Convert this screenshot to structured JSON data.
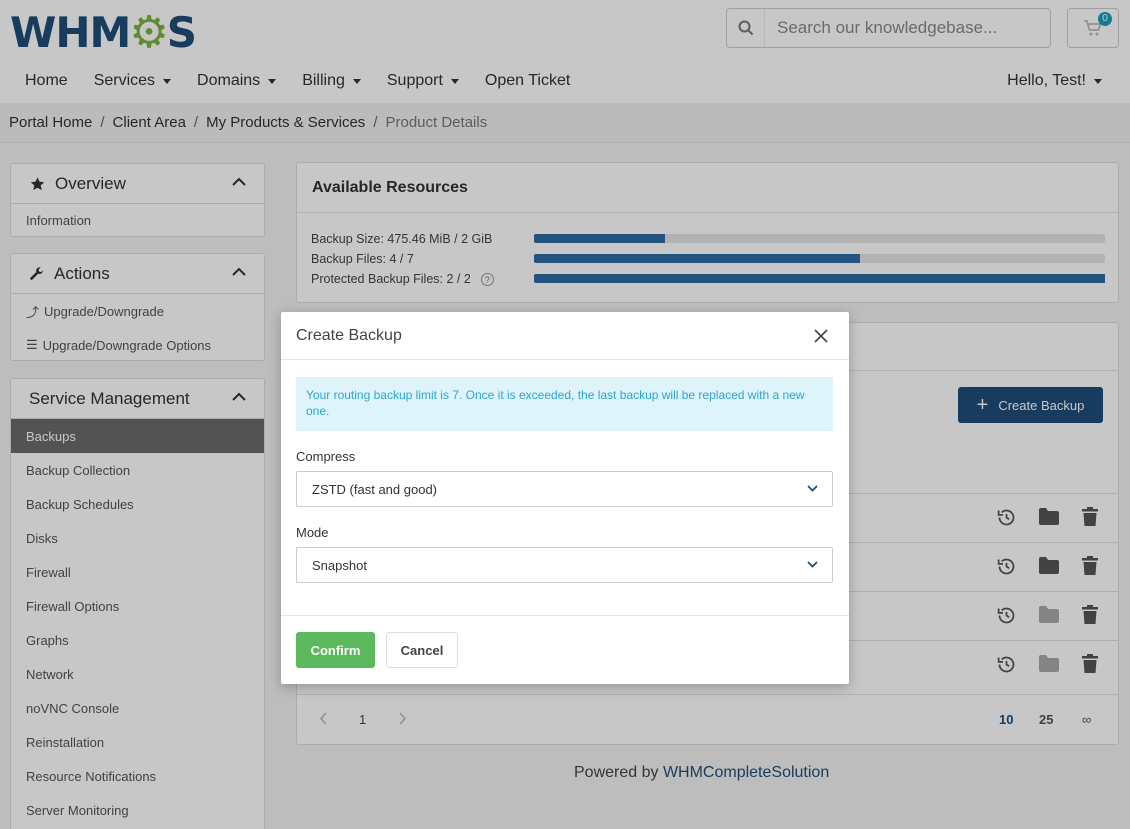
{
  "header": {
    "logo_text": "WHMCS",
    "search_placeholder": "Search our knowledgebase...",
    "cart_count": "0",
    "greeting": "Hello, Test!"
  },
  "nav": [
    {
      "label": "Home"
    },
    {
      "label": "Services"
    },
    {
      "label": "Domains"
    },
    {
      "label": "Billing"
    },
    {
      "label": "Support"
    },
    {
      "label": "Open Ticket"
    }
  ],
  "breadcrumb": [
    "Portal Home",
    "Client Area",
    "My Products & Services",
    "Product Details"
  ],
  "sidebar": {
    "overview": {
      "title": "Overview",
      "items": [
        "Information"
      ]
    },
    "actions": {
      "title": "Actions",
      "items": [
        "Upgrade/Downgrade",
        "Upgrade/Downgrade Options"
      ]
    },
    "service_management": {
      "title": "Service Management",
      "items": [
        "Backups",
        "Backup Collection",
        "Backup Schedules",
        "Disks",
        "Firewall",
        "Firewall Options",
        "Graphs",
        "Network",
        "noVNC Console",
        "Reinstallation",
        "Resource Notifications",
        "Server Monitoring"
      ],
      "active": "Backups"
    }
  },
  "resources": {
    "title": "Available Resources",
    "rows": [
      {
        "label": "Backup Size: 475.46 MiB / 2 GiB",
        "fraction": 0.23
      },
      {
        "label": "Backup Files: 4 / 7",
        "fraction": 0.571
      },
      {
        "label": "Protected Backup Files: 2 / 2",
        "fraction": 1.0
      }
    ]
  },
  "backups": {
    "create_label": "Create Backup",
    "pagination": {
      "current": "1",
      "sizes": [
        "10",
        "25",
        "∞"
      ]
    }
  },
  "footer": {
    "prefix": "Powered by ",
    "brand": "WHMCompleteSolution"
  },
  "modal": {
    "title": "Create Backup",
    "alert": "Your routing backup limit is 7. Once it is exceeded, the last backup will be replaced with a new one.",
    "compress_label": "Compress",
    "compress_value": "ZSTD (fast and good)",
    "mode_label": "Mode",
    "mode_value": "Snapshot",
    "confirm": "Confirm",
    "cancel": "Cancel"
  },
  "colors": {
    "brand": "#1f4d78",
    "accent_green": "#7cb342",
    "confirm": "#5cb85c",
    "alert_bg": "#dff3fb",
    "alert_text": "#2aa6d1"
  }
}
